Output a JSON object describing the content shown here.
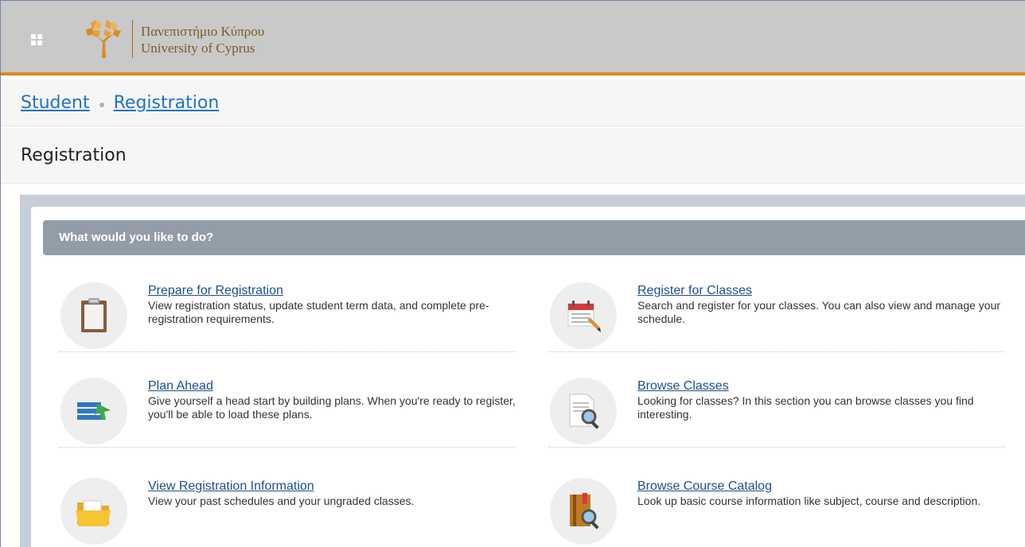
{
  "header": {
    "logo_greek": "Πανεπιστήμιο Κύπρου",
    "logo_english": "University of Cyprus",
    "accent_color": "#d98c1f"
  },
  "breadcrumb": {
    "items": [
      "Student",
      "Registration"
    ]
  },
  "page": {
    "title": "Registration"
  },
  "section": {
    "title": "What would you like to do?"
  },
  "actions": [
    {
      "label": "Prepare for Registration",
      "description": "View registration status, update student term data, and complete pre-registration requirements.",
      "icon": "clipboard-icon"
    },
    {
      "label": "Register for Classes",
      "description": "Search and register for your classes. You can also view and manage your schedule.",
      "icon": "calendar-pencil-icon"
    },
    {
      "label": "Plan Ahead",
      "description": "Give yourself a head start by building plans. When you're ready to register, you'll be able to load these plans.",
      "icon": "list-arrow-icon"
    },
    {
      "label": "Browse Classes",
      "description": "Looking for classes? In this section you can browse classes you find interesting.",
      "icon": "document-search-icon"
    },
    {
      "label": "View Registration Information",
      "description": "View your past schedules and your ungraded classes.",
      "icon": "folder-icon"
    },
    {
      "label": "Browse Course Catalog",
      "description": "Look up basic course information like subject, course and description.",
      "icon": "book-search-icon"
    }
  ]
}
